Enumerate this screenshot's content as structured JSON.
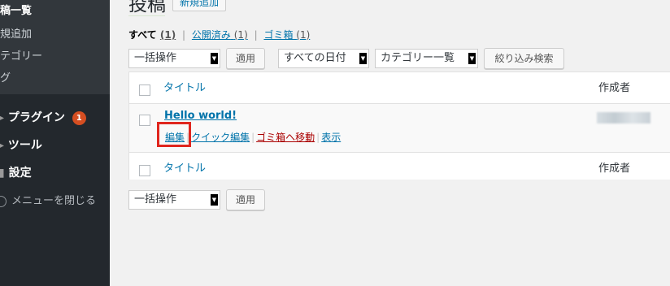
{
  "sidebar": {
    "posts_list": "稿一覧",
    "add_new": "規追加",
    "category": "テゴリー",
    "tag": "グ",
    "plugins": "プラグイン",
    "plugins_badge": "1",
    "tools": "ツール",
    "settings": "設定",
    "collapse": "メニューを閉じる"
  },
  "header": {
    "title": "投稿",
    "add_new": "新規追加"
  },
  "filters": {
    "all": "すべて",
    "all_count": "(1)",
    "published": "公開済み",
    "published_count": "(1)",
    "trash": "ゴミ箱",
    "trash_count": "(1)"
  },
  "toolbar": {
    "bulk_action": "一括操作",
    "apply": "適用",
    "date_filter": "すべての日付",
    "category_filter": "カテゴリー一覧",
    "filter_button": "絞り込み検索"
  },
  "table": {
    "header_title": "タイトル",
    "header_author": "作成者",
    "post": {
      "title": "Hello world!",
      "actions": {
        "edit": "編集",
        "quick_edit": "クイック編集",
        "trash": "ゴミ箱へ移動",
        "view": "表示"
      }
    },
    "footer_title": "タイトル",
    "footer_author": "作成者"
  },
  "bottom": {
    "bulk_action": "一括操作",
    "apply": "適用"
  },
  "colors": {
    "link": "#0073aa",
    "sidebar": "#23282d",
    "highlight": "#e0261e",
    "badge": "#d54e21"
  }
}
